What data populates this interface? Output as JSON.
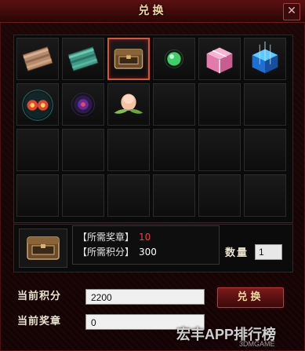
{
  "window": {
    "title": "兑换",
    "close_symbol": "✕"
  },
  "inventory": {
    "slots": [
      {
        "name": "fabric-bundle-brown",
        "selected": false
      },
      {
        "name": "fabric-bundle-teal",
        "selected": false
      },
      {
        "name": "treasure-chest",
        "selected": true
      },
      {
        "name": "green-orb",
        "selected": false
      },
      {
        "name": "pink-gift-box",
        "selected": false
      },
      {
        "name": "blue-crystal-cube",
        "selected": false
      },
      {
        "name": "fiery-orb-pair",
        "selected": false
      },
      {
        "name": "dark-purple-orb",
        "selected": false
      },
      {
        "name": "immortal-peach",
        "selected": false
      },
      {
        "name": "",
        "selected": false
      },
      {
        "name": "",
        "selected": false
      },
      {
        "name": "",
        "selected": false
      },
      {
        "name": "",
        "selected": false
      },
      {
        "name": "",
        "selected": false
      },
      {
        "name": "",
        "selected": false
      },
      {
        "name": "",
        "selected": false
      },
      {
        "name": "",
        "selected": false
      },
      {
        "name": "",
        "selected": false
      },
      {
        "name": "",
        "selected": false
      },
      {
        "name": "",
        "selected": false
      },
      {
        "name": "",
        "selected": false
      },
      {
        "name": "",
        "selected": false
      },
      {
        "name": "",
        "selected": false
      },
      {
        "name": "",
        "selected": false
      }
    ]
  },
  "requirements": {
    "badge_label": "【所需奖章】",
    "badge_value": "10",
    "points_label": "【所需积分】",
    "points_value": "300"
  },
  "quantity": {
    "label": "数量",
    "value": "1"
  },
  "stats": {
    "current_points_label": "当前积分",
    "current_points_value": "2200",
    "current_badges_label": "当前奖章",
    "current_badges_value": "0"
  },
  "exchange_button": {
    "label": "兑换"
  },
  "watermark": {
    "text": "宏丰APP排行榜",
    "sub_text": "3DMGAME"
  },
  "colors": {
    "accent_red": "#ff3b3b",
    "title_gold": "#f0d8a6",
    "selection_border": "#d4553a"
  }
}
